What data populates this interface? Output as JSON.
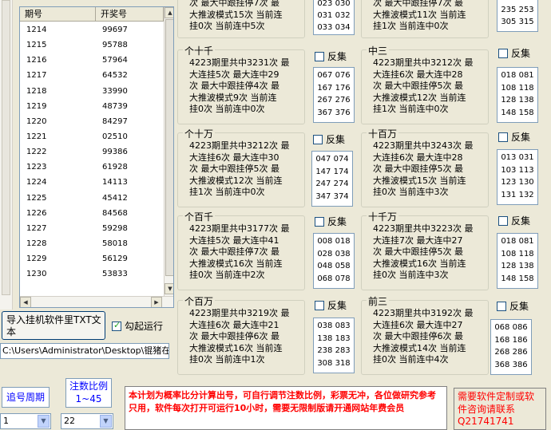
{
  "list": {
    "headers": [
      "期号",
      "开奖号"
    ],
    "rows": [
      [
        "1214",
        "99697"
      ],
      [
        "1215",
        "95788"
      ],
      [
        "1216",
        "57964"
      ],
      [
        "1217",
        "64532"
      ],
      [
        "1218",
        "33990"
      ],
      [
        "1219",
        "48739"
      ],
      [
        "1220",
        "84297"
      ],
      [
        "1221",
        "02510"
      ],
      [
        "1222",
        "99386"
      ],
      [
        "1223",
        "61928"
      ],
      [
        "1224",
        "14113"
      ],
      [
        "1225",
        "45412"
      ],
      [
        "1226",
        "84568"
      ],
      [
        "1227",
        "59298"
      ],
      [
        "1228",
        "58018"
      ],
      [
        "1229",
        "56129"
      ],
      [
        "1230",
        "53833"
      ]
    ]
  },
  "top_partial": {
    "left_text": [
      "次 最大中跟挂停7次 最",
      "大推波模式15次 当前连",
      "挂0次 当前连中5次"
    ],
    "left_nums": [
      "023 030",
      "031 032",
      "033 034"
    ],
    "right_text": [
      "次 最大中跟挂停7次 最",
      "大推波模式11次 当前连",
      "挂1次 当前连中0次"
    ],
    "right_nums": [
      "235 253",
      "305 315"
    ]
  },
  "groups": [
    {
      "title": "个十千",
      "text": [
        "4223期里共中3231次 最",
        "大连挂5次 最大连中29",
        "次 最大中跟挂停4次 最",
        "大推波模式9次 当前连",
        "挂0次 当前连中0次"
      ],
      "nums": [
        "067 076",
        "167 176",
        "267 276",
        "367 376"
      ],
      "checkbox": "反集"
    },
    {
      "title": "中三",
      "text": [
        "4223期里共中3212次 最",
        "大连挂6次 最大连中28",
        "次 最大中跟挂停5次 最",
        "大推波模式12次 当前连",
        "挂1次 当前连中0次"
      ],
      "nums": [
        "018 081",
        "108 118",
        "128 138",
        "148 158"
      ],
      "checkbox": "反集"
    },
    {
      "title": "个十万",
      "text": [
        "4223期里共中3212次 最",
        "大连挂6次 最大连中30",
        "次 最大中跟挂停5次 最",
        "大推波模式12次 当前连",
        "挂1次 当前连中0次"
      ],
      "nums": [
        "047 074",
        "147 174",
        "247 274",
        "347 374"
      ],
      "checkbox": "反集"
    },
    {
      "title": "十百万",
      "text": [
        "4223期里共中3243次 最",
        "大连挂6次 最大连中28",
        "次 最大中跟挂停5次 最",
        "大推波模式15次 当前连",
        "挂0次 当前连中3次"
      ],
      "nums": [
        "013 031",
        "103 113",
        "123 130",
        "131 132"
      ],
      "checkbox": "反集"
    },
    {
      "title": "个百千",
      "text": [
        "4223期里共中3177次 最",
        "大连挂5次 最大连中41",
        "次 最大中跟挂停7次 最",
        "大推波模式16次 当前连",
        "挂0次 当前连中2次"
      ],
      "nums": [
        "008 018",
        "028 038",
        "048 058",
        "068 078"
      ],
      "checkbox": "反集"
    },
    {
      "title": "十千万",
      "text": [
        "4223期里共中3223次 最",
        "大连挂7次 最大连中27",
        "次 最大中跟挂停5次 最",
        "大推波模式16次 当前连",
        "挂0次 当前连中3次"
      ],
      "nums": [
        "018 081",
        "108 118",
        "128 138",
        "148 158"
      ],
      "checkbox": "反集"
    },
    {
      "title": "个百万",
      "text": [
        "4223期里共中3219次 最",
        "大连挂6次 最大连中21",
        "次 最大中跟挂停6次 最",
        "大推波模式16次 当前连",
        "挂0次 当前连中1次"
      ],
      "nums": [
        "038 083",
        "138 183",
        "238 283",
        "308 318"
      ],
      "checkbox": "反集"
    },
    {
      "title": "前三",
      "text": [
        "4223期里共中3192次 最",
        "大连挂6次 最大连中27",
        "次 最大中跟挂停6次 最",
        "大推波模式14次 当前连",
        "挂0次 当前连中4次"
      ],
      "nums": [
        "068 086",
        "168 186",
        "268 286",
        "368 386"
      ],
      "checkbox": "反集"
    }
  ],
  "controls": {
    "import_button": "导入挂机软件里TXT文本",
    "check_run": "勾起运行",
    "path": "C:\\Users\\Administrator\\Desktop\\锟猪在",
    "period_label": "追号周期",
    "ratio_label": "注数比例",
    "ratio_range": "1~45",
    "period_value": "1",
    "ratio_value": "22",
    "note": "本计划为概率比分计算出号，可自行调节注数比例，彩票无冲，各位做研究参考只用，软件每次打开可运行10小时，需要无限制版请开通网站年费会员",
    "contact": "需要软件定制或软件咨询请联系Q21741741"
  },
  "colors": {
    "bg": "#ece9d8",
    "accent_blue": "#0000ff",
    "note_red": "#ff0000"
  }
}
